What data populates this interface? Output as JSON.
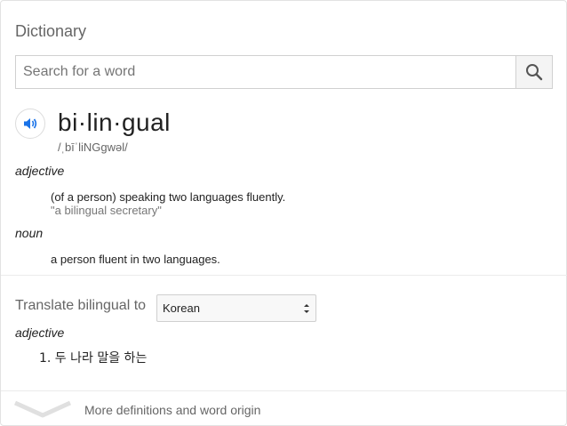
{
  "panel": {
    "title": "Dictionary"
  },
  "search": {
    "placeholder": "Search for a word"
  },
  "entry": {
    "word": "bi·lin·gual",
    "phonetic": "/ˌbīˈliNGɡwəl/",
    "senses": [
      {
        "part_of_speech": "adjective",
        "definition": "(of a person) speaking two languages fluently.",
        "example": "\"a bilingual secretary\""
      },
      {
        "part_of_speech": "noun",
        "definition": "a person fluent in two languages."
      }
    ]
  },
  "translate": {
    "label": "Translate bilingual to",
    "language": "Korean",
    "part_of_speech": "adjective",
    "items": [
      "1. 두 나라 말을 하는"
    ]
  },
  "footer": {
    "more_label": "More definitions and word origin"
  }
}
